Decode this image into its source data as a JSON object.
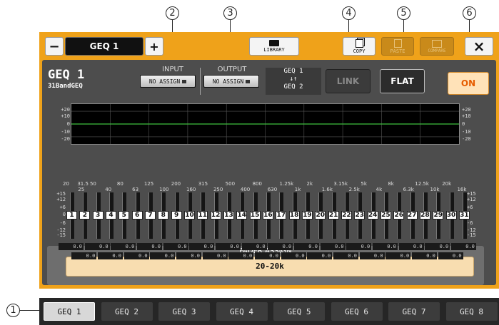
{
  "callouts": [
    "2",
    "3",
    "4",
    "5",
    "6",
    "1"
  ],
  "toolbar": {
    "minus": "−",
    "rack_name": "GEQ 1",
    "plus": "+",
    "library": "LIBRARY",
    "copy": "COPY",
    "paste": "PASTE",
    "compare": "COMPARE",
    "close": "×"
  },
  "header": {
    "title": "GEQ 1",
    "subtitle": "31BandGEQ",
    "input_label": "INPUT",
    "input_value": "NO ASSIGN",
    "output_label": "OUTPUT",
    "output_value": "NO ASSIGN",
    "link_top": "GEQ 1",
    "link_arrows": "↓↑",
    "link_bottom": "GEQ 2",
    "link_button": "LINK",
    "flat_button": "FLAT",
    "on_button": "ON"
  },
  "graph": {
    "ticks": [
      "+20",
      "+10",
      "0",
      "-10",
      "-20"
    ]
  },
  "fader_scale": [
    "+15",
    "+12",
    "+6",
    "0",
    "-6",
    "-12",
    "-15"
  ],
  "freq_upper": [
    "20",
    "50",
    "80",
    "125",
    "200",
    "315",
    "500",
    "800",
    "1.25k",
    "2k",
    "3.15k",
    "5k",
    "8k",
    "12.5k",
    "20k"
  ],
  "freq_upper_extra": [
    "31.5"
  ],
  "freq_lower": [
    "25",
    "40",
    "63",
    "100",
    "160",
    "250",
    "400",
    "630",
    "1k",
    "1.6k",
    "2.5k",
    "4k",
    "6.3k",
    "10k",
    "16k"
  ],
  "bands": [
    "1",
    "2",
    "3",
    "4",
    "5",
    "6",
    "7",
    "8",
    "9",
    "10",
    "11",
    "12",
    "13",
    "14",
    "15",
    "16",
    "17",
    "18",
    "19",
    "20",
    "21",
    "22",
    "23",
    "24",
    "25",
    "26",
    "27",
    "28",
    "29",
    "30",
    "31"
  ],
  "band_values": [
    "0.0",
    "0.0",
    "0.0",
    "0.0",
    "0.0",
    "0.0",
    "0.0",
    "0.0",
    "0.0",
    "0.0",
    "0.0",
    "0.0",
    "0.0",
    "0.0",
    "0.0",
    "0.0",
    "0.0",
    "0.0",
    "0.0",
    "0.0",
    "0.0",
    "0.0",
    "0.0",
    "0.0",
    "0.0",
    "0.0",
    "0.0",
    "0.0",
    "0.0",
    "0.0",
    "0.0"
  ],
  "fader_assign": {
    "label": "FADER ASSIGN",
    "value": "20-20k"
  },
  "tabs": [
    "GEQ 1",
    "GEQ 2",
    "GEQ 3",
    "GEQ 4",
    "GEQ 5",
    "GEQ 6",
    "GEQ 7",
    "GEQ 8"
  ],
  "selected_tab": "GEQ 1",
  "colors": {
    "frame": "#efa21a",
    "panel": "#4d4d4d",
    "graph_line": "#3fbf3f",
    "on_button": "#ffe2b8",
    "fader_assign_bar": "#f8ddb0"
  }
}
